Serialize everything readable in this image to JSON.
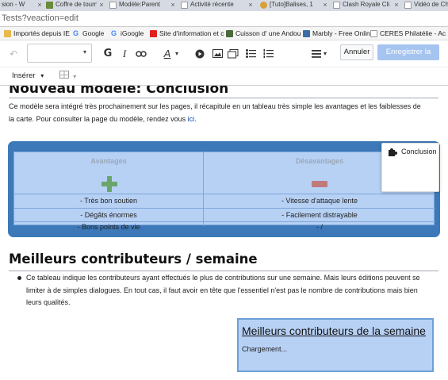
{
  "browser": {
    "tabs": [
      {
        "label": "sion - W",
        "color": "#ffffff"
      },
      {
        "label": "Coffre de tourn",
        "color": "#6a8a3c"
      },
      {
        "label": "Modèle:Parent",
        "color": "#ffffff"
      },
      {
        "label": "Activité récente",
        "color": "#ffffff"
      },
      {
        "label": "[Tuto]Balises, 1",
        "color": "#d9a03a"
      },
      {
        "label": "Clash Royale Cli",
        "color": "#ffffff"
      },
      {
        "label": "Vidéo de Ch",
        "color": "#ffffff"
      }
    ],
    "address": "Tests?veaction=edit",
    "bookmarks": [
      {
        "label": "Importés depuis IE",
        "icon": "folder-icon",
        "color": "#e8b84a"
      },
      {
        "label": "Google",
        "icon": "google-icon",
        "color": "#4285f4"
      },
      {
        "label": "iGoogle",
        "icon": "google-icon",
        "color": "#4285f4"
      },
      {
        "label": "Site d'information et c",
        "icon": "site-icon",
        "color": "#e02020"
      },
      {
        "label": "Cuisson d' une Andou",
        "icon": "site-icon",
        "color": "#4a6a3a"
      },
      {
        "label": "Marbly - Free Online",
        "icon": "site-icon",
        "color": "#3a6ea5"
      },
      {
        "label": "CERES Philatélie - Ac",
        "icon": "page-icon",
        "color": "#ffffff"
      }
    ]
  },
  "toolbar": {
    "annuler": "Annuler",
    "save": "Enregistrer la page",
    "inserer": "Insérer",
    "caret": "▾"
  },
  "content": {
    "heading1": "Nouveau modèle: Conclusion",
    "para1_a": "Ce modèle sera intégré très prochainement sur les pages, il récapitule en un tableau très simple les avantages et les faiblesses de",
    "para1_b": "la carte. Pour consulter la page du modèle, rendez vous",
    "para1_link": "ici",
    "para1_end": ".",
    "table": {
      "head_left": "Avantages",
      "head_right": "Désavantages",
      "left": [
        "- Très bon soutien",
        "- Dégâts énormes",
        "- Bons points de vie"
      ],
      "right": [
        "- Vitesse d'attaque lente",
        "- Facilement distrayable",
        "- /"
      ]
    },
    "popup_label": "Conclusion",
    "heading2": "Meilleurs contributeurs / semaine",
    "bullet_lines": [
      "Ce tableau indique les contributeurs ayant effectués le plus de contributions sur une semaine. Mais leurs éditions peuvent se",
      "limiter à de simples dialogues. En tout cas, il faut avoir en tête que l'essentiel n'est pas le nombre de contributions mais bien",
      "leurs qualités."
    ],
    "contrib_title": "Meilleurs contributeurs de la semaine",
    "contrib_loading": "Chargement..."
  }
}
